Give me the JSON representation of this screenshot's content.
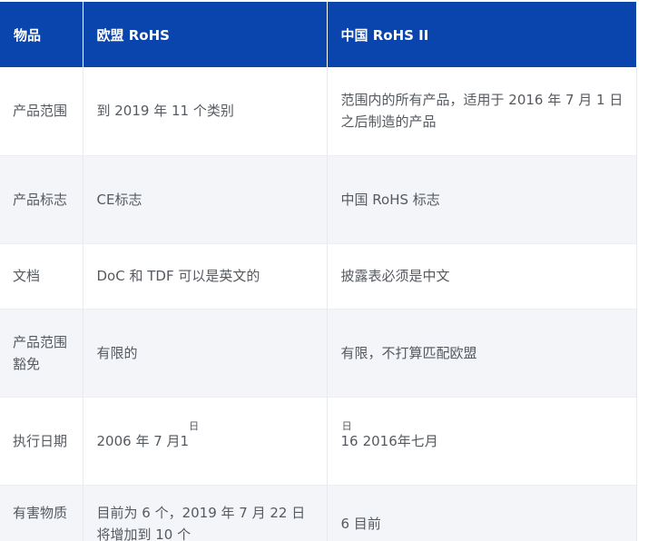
{
  "header": {
    "col1": "物品",
    "col2": "欧盟 RoHS",
    "col3": "中国 RoHS II"
  },
  "rows": [
    {
      "item": "产品范围",
      "eu": "到 2019 年 11 个类别",
      "cn": "范围内的所有产品，适用于 2016 年 7 月 1 日之后制造的产品"
    },
    {
      "item": "产品标志",
      "eu": "CE标志",
      "cn": "中国 RoHS 标志"
    },
    {
      "item": "文档",
      "eu": "DoC 和 TDF 可以是英文的",
      "cn": "披露表必须是中文"
    },
    {
      "item": "产品范围豁免",
      "eu": "有限的",
      "cn": "有限，不打算匹配欧盟"
    },
    {
      "item": "执行日期",
      "eu_main": "2006 年 7 月1",
      "eu_sup": "日",
      "cn_pre": "16",
      "cn_sup": "日",
      "cn_main": "2016年七月"
    },
    {
      "item": "有害物质",
      "eu": "目前为 6 个，2019 年 7 月 22 日将增加到 10 个",
      "cn": "6 目前"
    }
  ],
  "colors": {
    "header_bg": "#0a45ad",
    "header_text": "#ffffff",
    "stripe_bg": "#f3f5f8",
    "body_text": "#555a60"
  }
}
